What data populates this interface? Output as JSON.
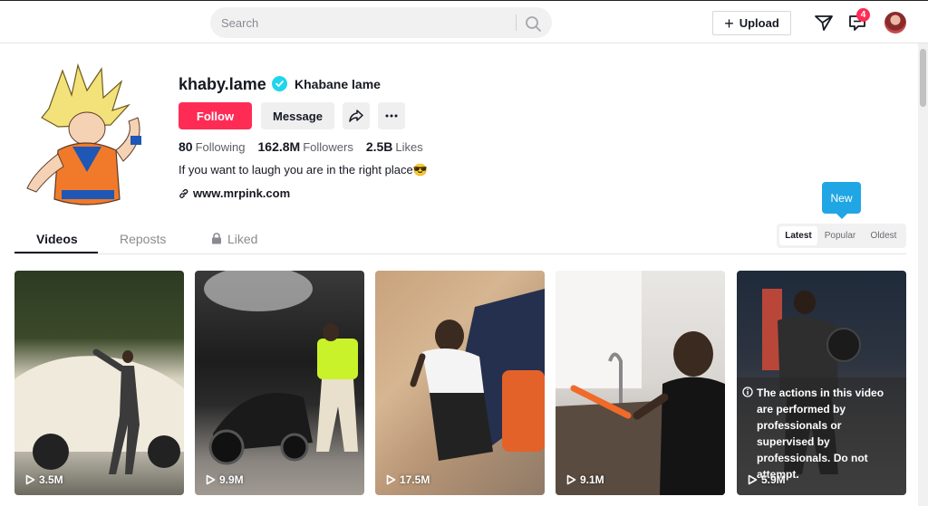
{
  "header": {
    "search_placeholder": "Search",
    "upload_label": "Upload",
    "inbox_badge": "4"
  },
  "profile": {
    "username": "khaby.lame",
    "nickname": "Khabane lame",
    "follow_label": "Follow",
    "message_label": "Message",
    "following_count": "80",
    "following_label": "Following",
    "followers_count": "162.8M",
    "followers_label": "Followers",
    "likes_count": "2.5B",
    "likes_label": "Likes",
    "bio": "If you want to laugh you are in the right place😎",
    "link": "www.mrpink.com"
  },
  "tabs": [
    {
      "label": "Videos"
    },
    {
      "label": "Reposts"
    },
    {
      "label": "Liked"
    }
  ],
  "sort": {
    "tooltip": "New",
    "options": [
      "Latest",
      "Popular",
      "Oldest"
    ],
    "selected": "Latest"
  },
  "videos": [
    {
      "views": "3.5M"
    },
    {
      "views": "9.9M"
    },
    {
      "views": "17.5M"
    },
    {
      "views": "9.1M"
    },
    {
      "views": "5.9M",
      "warning": "The actions in this video are performed by professionals or supervised by professionals. Do not attempt."
    }
  ],
  "colors": {
    "accent": "#fe2c55",
    "verified": "#20d5ec",
    "tooltip": "#20a6e4"
  }
}
